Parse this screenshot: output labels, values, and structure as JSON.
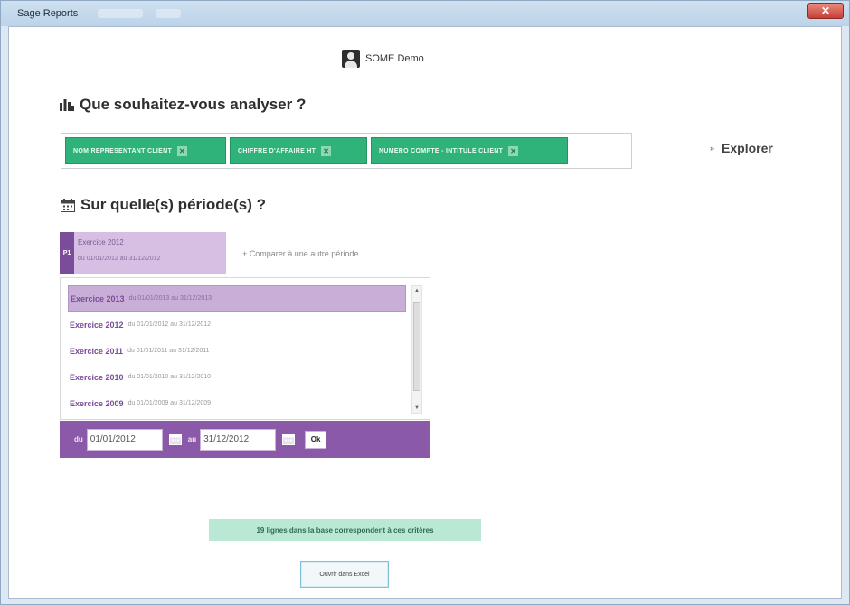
{
  "window": {
    "title": "Sage Reports",
    "close_label": "✕"
  },
  "user": {
    "name": "SOME Demo"
  },
  "analyze": {
    "title": "Que souhaitez-vous analyser ?",
    "chips": [
      "NOM REPRESENTANT CLIENT",
      "CHIFFRE D'AFFAIRE HT",
      "NUMERO COMPTE - INTITULE CLIENT"
    ],
    "explore_label": "Explorer"
  },
  "period": {
    "title": "Sur quelle(s) période(s) ?",
    "current": {
      "badge": "P1",
      "name": "Exercice 2012",
      "dates": "du 01/01/2012 au 31/12/2012"
    },
    "compare_label": "+ Comparer à une autre période",
    "list": [
      {
        "name": "Exercice 2013",
        "dates": "du 01/01/2013 au 31/12/2013",
        "selected": true
      },
      {
        "name": "Exercice 2012",
        "dates": "du 01/01/2012 au 31/12/2012",
        "selected": false
      },
      {
        "name": "Exercice 2011",
        "dates": "du 01/01/2011 au 31/12/2011",
        "selected": false
      },
      {
        "name": "Exercice 2010",
        "dates": "du 01/01/2010 au 31/12/2010",
        "selected": false
      },
      {
        "name": "Exercice 2009",
        "dates": "du 01/01/2009 au 31/12/2009",
        "selected": false
      }
    ],
    "from_label": "du",
    "from_value": "01/01/2012",
    "to_label": "au",
    "to_value": "31/12/2012",
    "ok_label": "Ok"
  },
  "footer": {
    "match_text": "19 lignes dans la base correspondent à ces critères",
    "excel_button": "Ouvrir dans Excel"
  },
  "colors": {
    "accent_green": "#2fb37a",
    "accent_purple": "#8a5aa8",
    "selected_row": "#c9aed8"
  }
}
